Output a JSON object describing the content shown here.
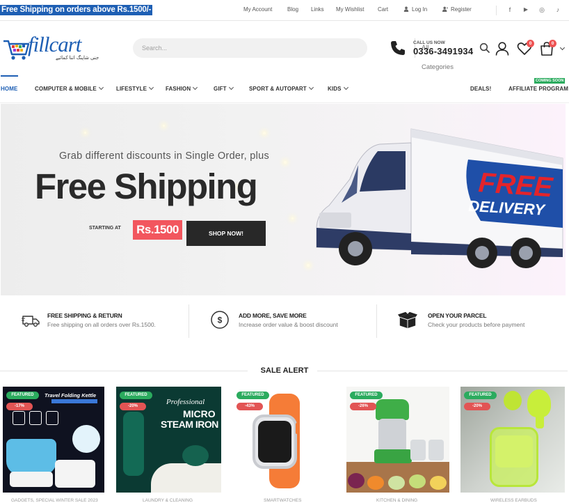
{
  "topbar": {
    "promo": "Free Shipping on orders above Rs.1500/-",
    "links": [
      "My Account",
      "Blog",
      "Links",
      "My Wishlist",
      "Cart",
      "Log In",
      "Register"
    ],
    "social": [
      "f",
      "▶",
      "◎",
      "♪"
    ]
  },
  "header": {
    "logo_text": "fillcart",
    "logo_tagline": "جنی شاپنگ اتنا کمائیے",
    "search": {
      "placeholder": "Search...",
      "category": "All Categories"
    },
    "call_label": "CALL US NOW",
    "phone": "0336-3491934",
    "wishlist_count": "0",
    "cart_count": "0"
  },
  "nav": {
    "items": [
      "HOME",
      "COMPUTER & MOBILE",
      "LIFESTYLE",
      "FASHION",
      "GIFT",
      "SPORT & AUTOPART",
      "KIDS"
    ],
    "right": [
      "DEALS!",
      "AFFILIATE PROGRAM"
    ],
    "coming_soon": "COMING SOON"
  },
  "banner": {
    "subtitle": "Grab different discounts in Single Order, plus",
    "title": "Free Shipping",
    "starting_label": "STARTING AT",
    "price": "Rs.1500",
    "button": "SHOP NOW!",
    "truck_text": [
      "FREE",
      "DELIVERY"
    ]
  },
  "features": [
    {
      "icon": "truck-icon",
      "title": "FREE SHIPPING & RETURN",
      "desc": "Free shipping on all orders over Rs.1500."
    },
    {
      "icon": "dollar-icon",
      "title": "ADD MORE, SAVE MORE",
      "desc": "Increase order value & boost discount"
    },
    {
      "icon": "box-icon",
      "title": "OPEN YOUR PARCEL",
      "desc": "Check your products before payment"
    }
  ],
  "sale": {
    "title": "SALE ALERT",
    "products": [
      {
        "badge": "FEATURED",
        "discount": "-17%",
        "image_text": [
          "Travel Folding Kettle"
        ],
        "category": "GADGETS, SPECIAL WINTER SALE 2023"
      },
      {
        "badge": "FEATURED",
        "discount": "-20%",
        "image_text": [
          "Professional",
          "MICRO",
          "STEAM IRON"
        ],
        "category": "LAUNDRY & CLEANING"
      },
      {
        "badge": "FEATURED",
        "discount": "-43%",
        "image_text": [],
        "category": "SMARTWATCHES"
      },
      {
        "badge": "FEATURED",
        "discount": "-26%",
        "image_text": [],
        "category": "KITCHEN & DINING"
      },
      {
        "badge": "FEATURED",
        "discount": "-20%",
        "image_text": [],
        "category": "WIRELESS EARBUDS"
      }
    ]
  },
  "colors": {
    "primary": "#1e5fb4",
    "badge_green": "#2bab5e",
    "badge_red": "#e25454",
    "price_tag": "#f2565e"
  }
}
